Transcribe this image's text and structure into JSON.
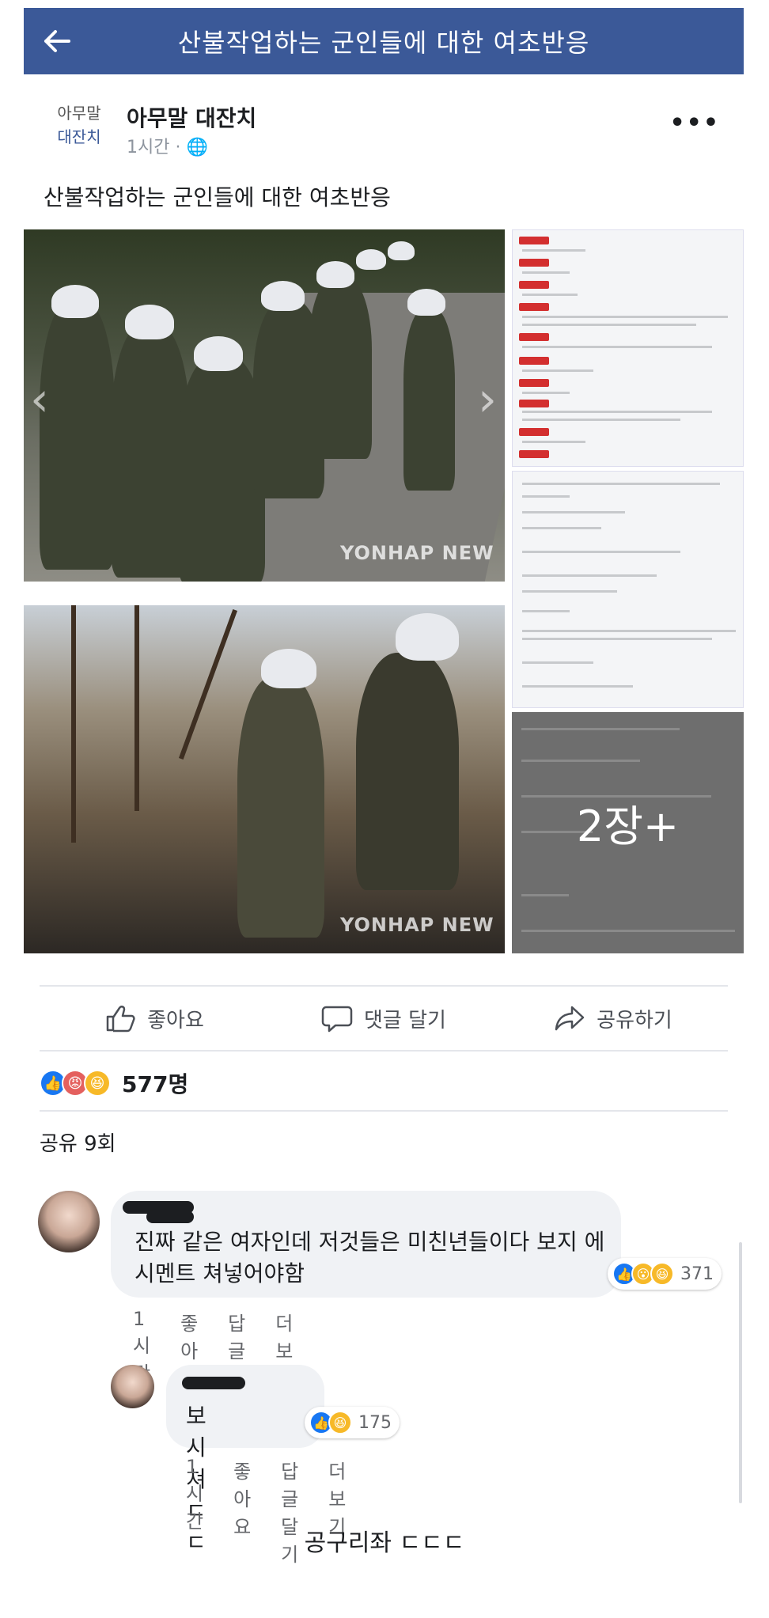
{
  "topbar": {
    "back_icon": "left-arrow-icon",
    "title": "산불작업하는 군인들에 대한 여초반응"
  },
  "post": {
    "avatar_line1": "아무말",
    "avatar_line2": "대잔치",
    "page_name": "아무말 대잔치",
    "time": "1시간 · 🌐",
    "more_icon": "•••",
    "text": "산불작업하는 군인들에 대한 여초반응",
    "watermark": "YONHAP NEW",
    "more_photos": "2장+"
  },
  "actions": {
    "like": {
      "icon": "thumbs-up-icon",
      "label": "좋아요"
    },
    "comment": {
      "icon": "comment-icon",
      "label": "댓글 달기"
    },
    "share": {
      "icon": "share-icon",
      "label": "공유하기"
    }
  },
  "reactions": {
    "like": "👍",
    "angry": "😡",
    "haha": "😆",
    "count": "577명"
  },
  "shares": "공유 9회",
  "comments": [
    {
      "text": "진짜 같은 여자인데 저것들은 미친년들이다 보지 에 시멘트 쳐넣어야함",
      "react_like": "👍",
      "react_wow": "😮",
      "react_haha": "😆",
      "react_count": "371",
      "time": "1시간",
      "like": "좋아요",
      "reply": "답글 달기",
      "more": "더 보기"
    },
    {
      "text": "보시쳐 ㄷㄷ",
      "react_like": "👍",
      "react_haha": "😆",
      "react_count": "175",
      "time": "1시간",
      "like": "좋아요",
      "reply": "답글 달기",
      "more": "더 보기"
    }
  ],
  "footer": "공구리좌 ㄷㄷㄷ",
  "colors": {
    "facebook_blue": "#3b5998",
    "like_blue": "#1877f2",
    "angry_red": "#e4605e",
    "haha_yellow": "#f7b928"
  }
}
